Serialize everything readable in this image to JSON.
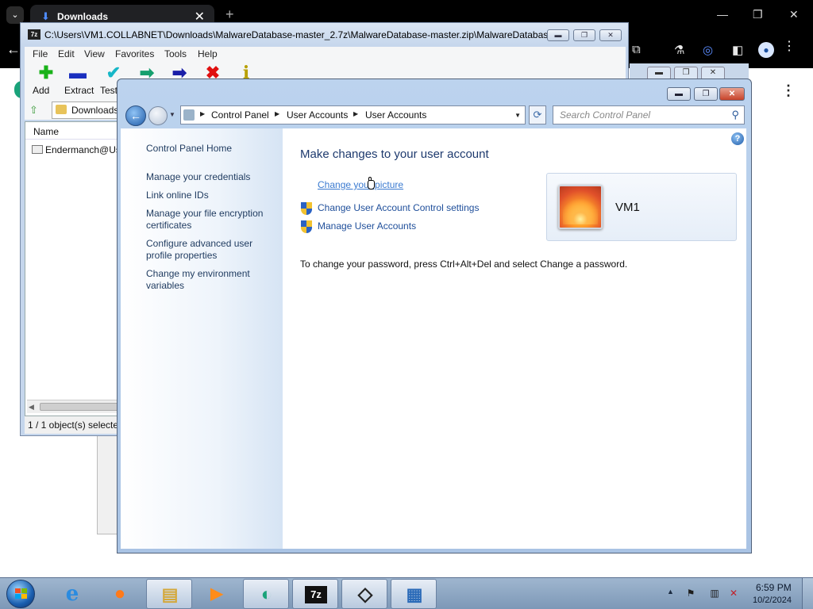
{
  "browser": {
    "tab_title": "Downloads",
    "tab_close": "✕",
    "new_tab": "+",
    "menu_dots": "⋮",
    "page_menu_dots": "⋮",
    "icons": [
      "back-arrow-icon",
      "extensions-icon",
      "labs-icon",
      "sync-icon",
      "sidebar-icon",
      "profile-icon",
      "menu-icon"
    ]
  },
  "zip": {
    "title": "C:\\Users\\VM1.COLLABNET\\Downloads\\MalwareDatabase-master_2.7z\\MalwareDatabase-master.zip\\MalwareDatabas...",
    "app_icon": "7z",
    "menus": [
      "File",
      "Edit",
      "View",
      "Favorites",
      "Tools",
      "Help"
    ],
    "toolbar": [
      {
        "label": "Add",
        "icon": "plus-icon",
        "color": "#19b219",
        "glyph": "✚"
      },
      {
        "label": "Extract",
        "icon": "minus-icon",
        "color": "#1a2fbf",
        "glyph": "▬"
      },
      {
        "label": "Test",
        "icon": "check-icon",
        "color": "#17b7c7",
        "glyph": "✔"
      },
      {
        "label": "",
        "icon": "copy-arrow-icon",
        "color": "#169f6e",
        "glyph": "➡"
      },
      {
        "label": "",
        "icon": "move-arrow-icon",
        "color": "#1a1fa8",
        "glyph": "➡"
      },
      {
        "label": "",
        "icon": "delete-icon",
        "color": "#e01010",
        "glyph": "✖"
      },
      {
        "label": "",
        "icon": "info-icon",
        "color": "#b8a000",
        "glyph": "i"
      }
    ],
    "path": "Downloads",
    "column_name": "Name",
    "row": "Endermanch@Us",
    "status": "1 / 1 object(s) selecte"
  },
  "control_panel": {
    "breadcrumbs": [
      "Control Panel",
      "User Accounts",
      "User Accounts"
    ],
    "search_placeholder": "Search Control Panel",
    "left_links": [
      "Control Panel Home",
      "Manage your credentials",
      "Link online IDs",
      "Manage your file encryption certificates",
      "Configure advanced user profile properties",
      "Change my environment variables"
    ],
    "heading": "Make changes to your user account",
    "tasks": {
      "change_picture": "Change your picture",
      "uac_settings": "Change User Account Control settings",
      "manage_accounts": "Manage User Accounts"
    },
    "user_name": "VM1",
    "password_note": "To change your password, press Ctrl+Alt+Del and select Change a password.",
    "help_glyph": "?"
  },
  "taskbar": {
    "items": [
      {
        "name": "internet-explorer",
        "glyph": "e",
        "color": "#2a8be0"
      },
      {
        "name": "firefox",
        "glyph": "●",
        "color": "#ff7a1a"
      },
      {
        "name": "file-explorer",
        "glyph": "▤",
        "color": "#e8c35a"
      },
      {
        "name": "media-player",
        "glyph": "▶",
        "color": "#ff8c1a"
      },
      {
        "name": "generic-app",
        "glyph": "◐",
        "color": "#1aa37a"
      },
      {
        "name": "7zip",
        "glyph": "7z",
        "color": "#111111"
      },
      {
        "name": "unity",
        "glyph": "◇",
        "color": "#222222"
      },
      {
        "name": "control-panel",
        "glyph": "▦",
        "color": "#2a6ab8"
      }
    ],
    "time": "6:59 PM",
    "date": "10/2/2024"
  },
  "colors": {
    "accent": "#1e4e9a",
    "window_frame": "#bcd3ee",
    "taskbar": "#8aa3bf"
  }
}
